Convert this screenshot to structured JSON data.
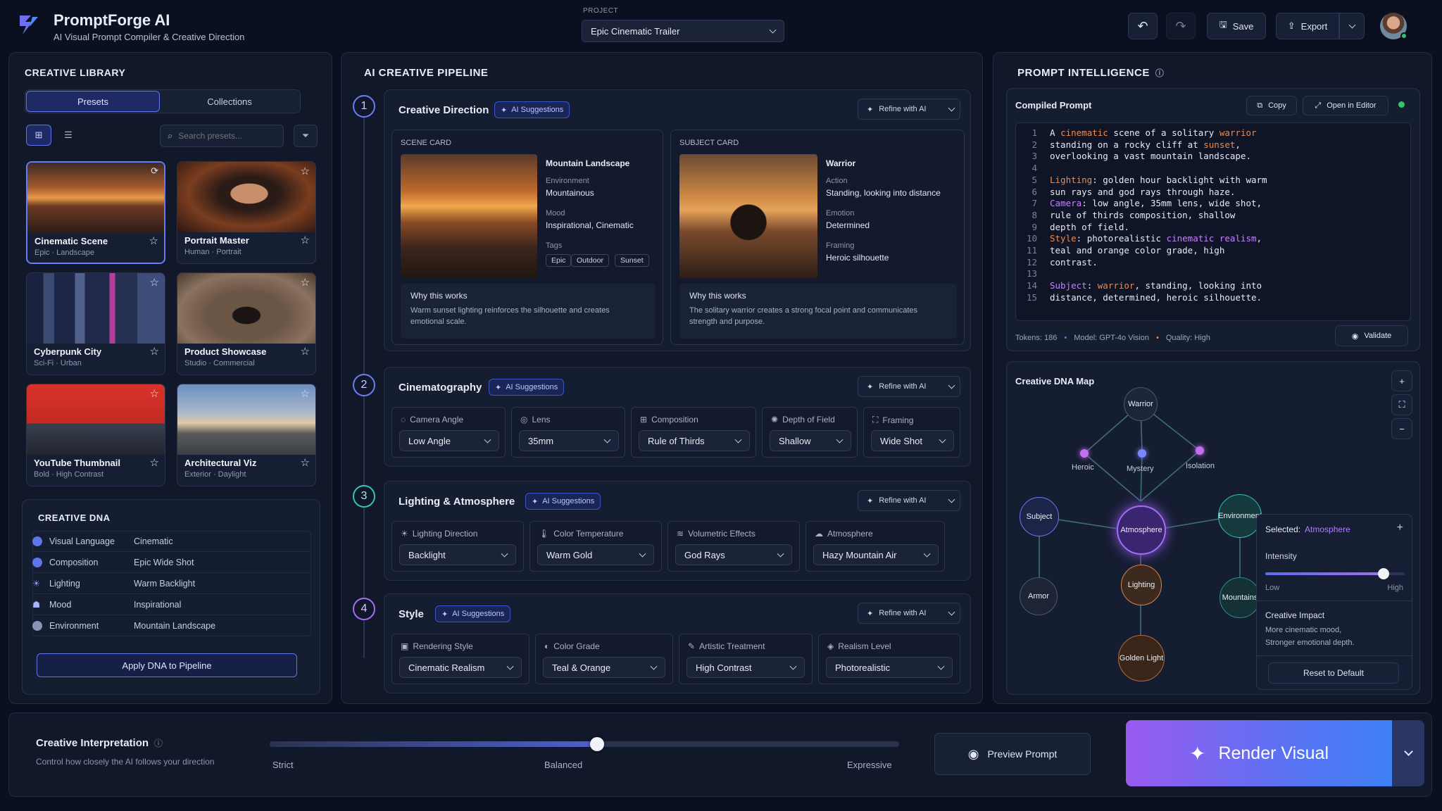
{
  "app": {
    "name": "PromptForge AI",
    "tagline": "AI Visual Prompt Compiler & Creative Direction"
  },
  "project": {
    "label": "PROJECT",
    "value": "Epic Cinematic Trailer"
  },
  "toolbar": {
    "save": "Save",
    "export": "Export"
  },
  "library": {
    "title": "CREATIVE LIBRARY",
    "tabs": [
      "Presets",
      "Collections"
    ],
    "search_placeholder": "Search presets...",
    "presets": [
      {
        "title": "Cinematic Scene",
        "sub": "Epic · Landscape"
      },
      {
        "title": "Portrait Master",
        "sub": "Human · Portrait"
      },
      {
        "title": "Cyberpunk City",
        "sub": "Sci-Fi · Urban"
      },
      {
        "title": "Product Showcase",
        "sub": "Studio · Commercial"
      },
      {
        "title": "YouTube Thumbnail",
        "sub": "Bold · High Contrast"
      },
      {
        "title": "Architectural Viz",
        "sub": "Exterior · Daylight"
      }
    ]
  },
  "dna": {
    "title": "CREATIVE DNA",
    "rows": [
      {
        "k": "Visual Language",
        "v": "Cinematic"
      },
      {
        "k": "Composition",
        "v": "Epic Wide Shot"
      },
      {
        "k": "Lighting",
        "v": "Warm Backlight"
      },
      {
        "k": "Mood",
        "v": "Inspirational"
      },
      {
        "k": "Environment",
        "v": "Mountain Landscape"
      }
    ],
    "apply": "Apply DNA to Pipeline"
  },
  "pipeline": {
    "title": "AI CREATIVE PIPELINE",
    "ai_chip": "AI Suggestions",
    "refine": "Refine with AI",
    "steps": [
      {
        "n": "1",
        "title": "Creative Direction"
      },
      {
        "n": "2",
        "title": "Cinematography"
      },
      {
        "n": "3",
        "title": "Lighting & Atmosphere"
      },
      {
        "n": "4",
        "title": "Style"
      }
    ],
    "scene": {
      "label": "SCENE CARD",
      "title": "Mountain Landscape",
      "f1k": "Environment",
      "f1v": "Mountainous",
      "f2k": "Mood",
      "f2v": "Inspirational, Cinematic",
      "f3k": "Tags",
      "tags": [
        "Epic",
        "Outdoor",
        "Sunset"
      ],
      "why": "Why this works",
      "why_text": "Warm sunset lighting reinforces the silhouette and creates emotional scale."
    },
    "subject": {
      "label": "SUBJECT CARD",
      "title": "Warrior",
      "f1k": "Action",
      "f1v": "Standing, looking into distance",
      "f2k": "Emotion",
      "f2v": "Determined",
      "f3k": "Framing",
      "f3v": "Heroic silhouette",
      "why": "Why this works",
      "why_text": "The solitary warrior creates a strong focal point and communicates strength and purpose."
    },
    "cine": [
      {
        "label": "Camera Angle",
        "value": "Low Angle"
      },
      {
        "label": "Lens",
        "value": "35mm"
      },
      {
        "label": "Composition",
        "value": "Rule of Thirds"
      },
      {
        "label": "Depth of Field",
        "value": "Shallow"
      },
      {
        "label": "Framing",
        "value": "Wide Shot"
      }
    ],
    "light": [
      {
        "label": "Lighting Direction",
        "value": "Backlight"
      },
      {
        "label": "Color Temperature",
        "value": "Warm Gold"
      },
      {
        "label": "Volumetric Effects",
        "value": "God Rays"
      },
      {
        "label": "Atmosphere",
        "value": "Hazy Mountain Air"
      }
    ],
    "style": [
      {
        "label": "Rendering Style",
        "value": "Cinematic Realism"
      },
      {
        "label": "Color Grade",
        "value": "Teal & Orange"
      },
      {
        "label": "Artistic Treatment",
        "value": "High Contrast"
      },
      {
        "label": "Realism Level",
        "value": "Photorealistic"
      }
    ]
  },
  "intel": {
    "title": "PROMPT INTELLIGENCE",
    "compiled": "Compiled Prompt",
    "copy": "Copy",
    "open": "Open in Editor",
    "line_numbers": [
      "1",
      "2",
      "3",
      "4",
      "5",
      "6",
      "7",
      "8",
      "9",
      "10",
      "11",
      "12",
      "13",
      "14",
      "15"
    ],
    "tokens": "Tokens: 186",
    "model": "Model: GPT-4o Vision",
    "quality": "Quality: High",
    "validate": "Validate"
  },
  "map": {
    "title": "Creative DNA Map",
    "nodes": {
      "warrior": "Warrior",
      "heroic": "Heroic",
      "mystery": "Mystery",
      "isolation": "Isolation",
      "subject": "Subject",
      "atmosphere": "Atmosphere",
      "environment": "Environment",
      "armor": "Armor",
      "lighting": "Lighting",
      "mountains": "Mountains",
      "golden": "Golden Light"
    },
    "selected_label": "Selected:",
    "selected_value": "Atmosphere",
    "intensity": "Intensity",
    "intensity_value": 0.85,
    "low": "Low",
    "high": "High",
    "impact_title": "Creative Impact",
    "impact_text1": "More cinematic mood,",
    "impact_text2": "Stronger emotional depth.",
    "reset": "Reset to Default"
  },
  "bottom": {
    "title": "Creative Interpretation",
    "sub": "Control how closely the AI follows your direction",
    "value": 0.52,
    "stops": [
      "Strict",
      "Balanced",
      "Expressive"
    ],
    "preview": "Preview Prompt",
    "render": "Render Visual"
  },
  "colors": {
    "accent": "#6a7cf2",
    "kw_orange": "#f08a4b",
    "kw_purple": "#c780ff",
    "bg": "#0b1020"
  }
}
